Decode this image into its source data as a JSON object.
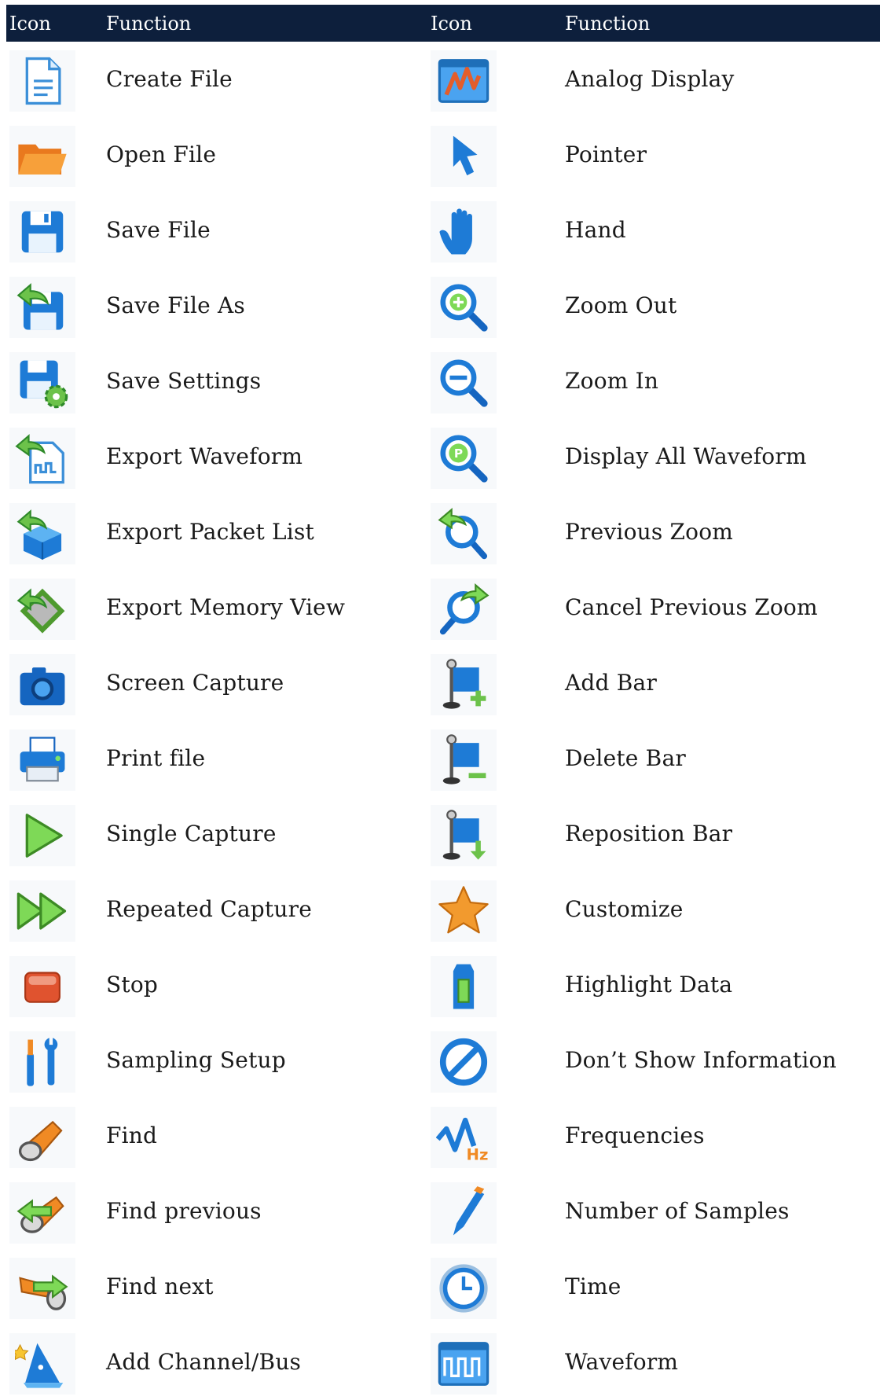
{
  "header": {
    "col1": "Icon",
    "col2": "Function",
    "col3": "Icon",
    "col4": "Function"
  },
  "rows": [
    {
      "left": {
        "icon": "create-file-icon",
        "label": "Create File"
      },
      "right": {
        "icon": "analog-display-icon",
        "label": "Analog Display"
      }
    },
    {
      "left": {
        "icon": "open-file-icon",
        "label": "Open File"
      },
      "right": {
        "icon": "pointer-icon",
        "label": "Pointer"
      }
    },
    {
      "left": {
        "icon": "save-file-icon",
        "label": "Save File"
      },
      "right": {
        "icon": "hand-icon",
        "label": "Hand"
      }
    },
    {
      "left": {
        "icon": "save-file-as-icon",
        "label": "Save File As"
      },
      "right": {
        "icon": "zoom-plus-icon",
        "label": "Zoom Out"
      }
    },
    {
      "left": {
        "icon": "save-settings-icon",
        "label": "Save Settings"
      },
      "right": {
        "icon": "zoom-minus-icon",
        "label": "Zoom In"
      }
    },
    {
      "left": {
        "icon": "export-waveform-icon",
        "label": "Export Waveform"
      },
      "right": {
        "icon": "display-all-icon",
        "label": "Display All Waveform"
      }
    },
    {
      "left": {
        "icon": "export-packet-icon",
        "label": "Export Packet List"
      },
      "right": {
        "icon": "previous-zoom-icon",
        "label": "Previous Zoom"
      }
    },
    {
      "left": {
        "icon": "export-memory-icon",
        "label": "Export Memory View"
      },
      "right": {
        "icon": "cancel-zoom-icon",
        "label": "Cancel Previous Zoom"
      }
    },
    {
      "left": {
        "icon": "camera-icon",
        "label": "Screen Capture"
      },
      "right": {
        "icon": "add-bar-icon",
        "label": "Add Bar"
      }
    },
    {
      "left": {
        "icon": "printer-icon",
        "label": "Print file"
      },
      "right": {
        "icon": "delete-bar-icon",
        "label": "Delete Bar"
      }
    },
    {
      "left": {
        "icon": "play-icon",
        "label": "Single Capture"
      },
      "right": {
        "icon": "reposition-bar-icon",
        "label": "Reposition Bar"
      }
    },
    {
      "left": {
        "icon": "fast-forward-icon",
        "label": "Repeated Capture"
      },
      "right": {
        "icon": "star-icon",
        "label": "Customize"
      }
    },
    {
      "left": {
        "icon": "stop-icon",
        "label": "Stop"
      },
      "right": {
        "icon": "highlight-icon",
        "label": "Highlight Data"
      }
    },
    {
      "left": {
        "icon": "tools-icon",
        "label": "Sampling Setup"
      },
      "right": {
        "icon": "no-info-icon",
        "label": "Don’t Show Information"
      }
    },
    {
      "left": {
        "icon": "flashlight-icon",
        "label": "Find"
      },
      "right": {
        "icon": "frequency-icon",
        "label": "Frequencies"
      }
    },
    {
      "left": {
        "icon": "find-previous-icon",
        "label": "Find previous"
      },
      "right": {
        "icon": "pen-icon",
        "label": "Number of Samples"
      }
    },
    {
      "left": {
        "icon": "find-next-icon",
        "label": "Find next"
      },
      "right": {
        "icon": "clock-icon",
        "label": "Time"
      }
    },
    {
      "left": {
        "icon": "wizard-icon",
        "label": "Add Channel/Bus"
      },
      "right": {
        "icon": "waveform-icon",
        "label": "Waveform"
      }
    }
  ]
}
